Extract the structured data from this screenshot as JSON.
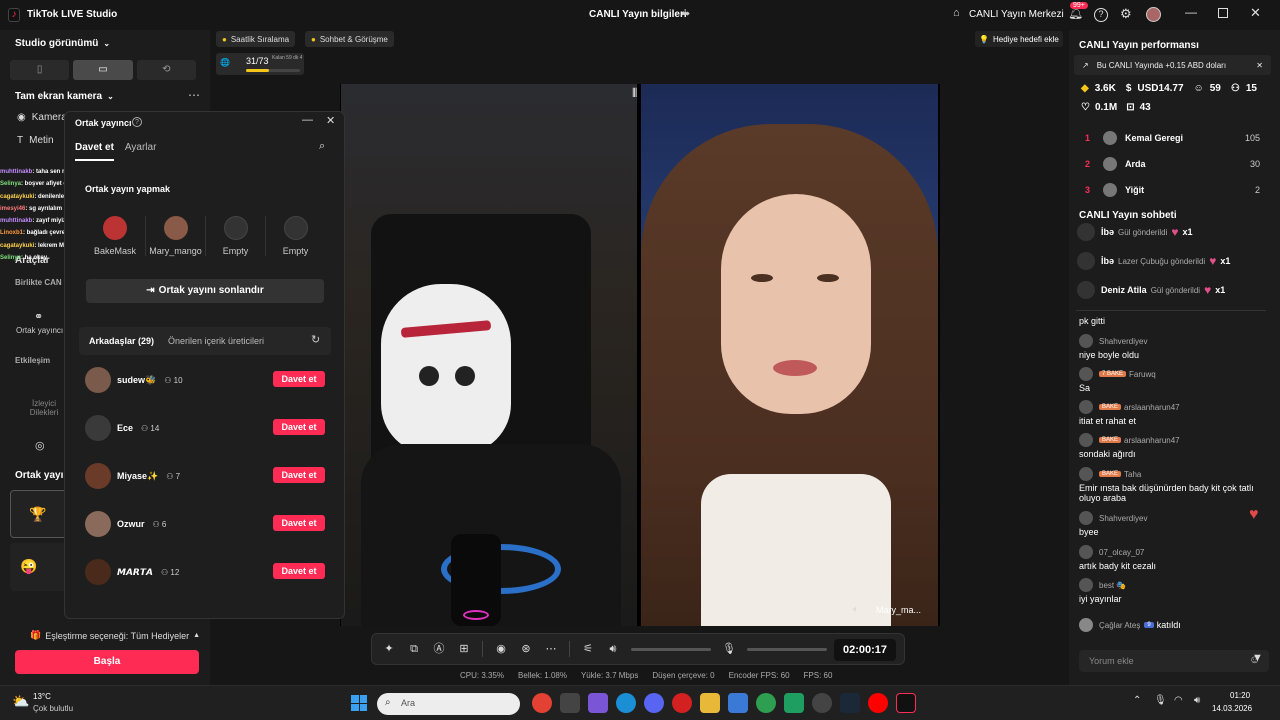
{
  "app": {
    "title": "TikTok LIVE Studio",
    "center_title": "CANLI Yayın bilgileri",
    "live_center": "CANLI Yayın Merkezi",
    "notif_badge": "99+"
  },
  "left": {
    "studio_view": "Studio görünümü",
    "fullscreen_camera": "Tam ekran kamera",
    "source_camera": "Kamera",
    "source_text": "Metin",
    "tools": "Araçlar",
    "together": "Birlikte CAN",
    "cohost_short": "Ortak yayıncı",
    "interaction": "Etkileşim",
    "viewer_requests": "İzleyici Dilekleri",
    "cohost_section": "Ortak yayın",
    "match_option": "Eşleştirme seçeneği: Tüm Hediyeler",
    "start": "Başla"
  },
  "overlay_chat": [
    {
      "user": "muhttinakb",
      "text": ": taha sen misin",
      "color": "#c38cff"
    },
    {
      "user": "Selinya",
      "text": ": boşver afiyet olsun",
      "color": "#7ee07e"
    },
    {
      "user": "cagataykuki",
      "text": ": denilenlere göre titi ben boznuşum",
      "color": "#ffd34d"
    },
    {
      "user": "imesyi46",
      "text": ": sg ayrılalım abi",
      "color": "#ff7a7a"
    },
    {
      "user": "muhttinakb",
      "text": ": zayıf miyiz abi",
      "color": "#c38cff"
    },
    {
      "user": "Linoxb1",
      "text": ": bağladı çevre kontrol",
      "color": "#ff9a3c"
    },
    {
      "user": "cagataykuki",
      "text": ": lekrem Mary hanum ben cago hatırladınız mı",
      "color": "#ffd34d"
    },
    {
      "user": "Selinya",
      "text": ": ha okey",
      "color": "#7ee07e"
    }
  ],
  "top_chips": {
    "hourly": "Saatlik Sıralama",
    "chat_meet": "Sohbet & Görüşme",
    "goal": "Hediye hedefi ekle",
    "progress": "31/73",
    "progress_fraction": 0.42,
    "timer_small": "Kalan 59 dk 48 sn"
  },
  "cohost": {
    "title": "Ortak yayıncı",
    "tab_invite": "Davet et",
    "tab_settings": "Ayarlar",
    "section": "Ortak yayın yapmak",
    "slots": [
      {
        "name": "BakeMask",
        "empty": false
      },
      {
        "name": "Mary_mango",
        "empty": false
      },
      {
        "name": "Empty",
        "empty": true
      },
      {
        "name": "Empty",
        "empty": true
      }
    ],
    "end_button": "Ortak yayını sonlandır",
    "friends_tab": "Arkadaşlar (29)",
    "suggested_tab": "Önerilen içerik üreticileri",
    "invite_label": "Davet et",
    "friends": [
      {
        "name": "sudew🐝",
        "count": "10"
      },
      {
        "name": "Ece",
        "count": "14"
      },
      {
        "name": "Miyase✨",
        "count": "7"
      },
      {
        "name": "Ozwur",
        "count": "6"
      },
      {
        "name": "𝙈𝘼𝙍𝙏𝘼",
        "count": "12"
      }
    ]
  },
  "video": {
    "right_label": "Mary_ma..."
  },
  "controls": {
    "timer": "02:00:17",
    "volume_level": 0.0,
    "mic_level": 0.0
  },
  "stats": [
    "CPU: 3.35%",
    "Bellek: 1.08%",
    "Yükle: 3.7 Mbps",
    "Düşen çerçeve: 0",
    "Encoder FPS: 60",
    "FPS: 60"
  ],
  "right": {
    "perf_title": "CANLI Yayın performansı",
    "earn_banner": "Bu CANLI Yayında +0.15 ABD doları",
    "metrics": {
      "diamonds": "3.6K",
      "usd": "USD14.77",
      "viewers": "59",
      "new": "15",
      "likes": "0.1M",
      "gifts": "43"
    },
    "ranks": [
      {
        "pos": "1",
        "name": "Kemal Geregi",
        "score": "105"
      },
      {
        "pos": "2",
        "name": "Arda",
        "score": "30"
      },
      {
        "pos": "3",
        "name": "Yiğit",
        "score": "2"
      }
    ],
    "chat_title": "CANLI Yayın sohbeti",
    "gift_events": [
      {
        "user": "İbə",
        "text": "Gül gönderildi",
        "mult": "x1"
      },
      {
        "user": "İbə",
        "text": "Lazer Çubuğu gönderildi",
        "mult": "x1"
      },
      {
        "user": "Deniz Atila",
        "text": "Gül gönderildi",
        "mult": "x1"
      }
    ],
    "messages": [
      {
        "user": "",
        "text": "pk gitti",
        "badge": ""
      },
      {
        "user": "Shahverdiyev",
        "text": "niye boyle oldu",
        "badge": ""
      },
      {
        "user": "Faruwq",
        "text": "Sa",
        "badge": "7 BAKE"
      },
      {
        "user": "arslaanharun47",
        "text": "itiat et rahat et",
        "badge": "BAKE"
      },
      {
        "user": "arslaanharun47",
        "text": "sondaki ağırdı",
        "badge": "BAKE"
      },
      {
        "user": "Taha",
        "text": "Emir ınsta bak düşünürden bady kit çok tatlı oluyo araba",
        "badge": "BAKE"
      },
      {
        "user": "Shahverdiyev",
        "text": "byee",
        "badge": ""
      },
      {
        "user": "07_olcay_07",
        "text": "artık bady kit cezalı",
        "badge": ""
      },
      {
        "user": "best 🎭",
        "text": "iyi yayınlar",
        "badge": ""
      }
    ],
    "joined_user": "Çağlar Ateş",
    "joined_badge": "9",
    "joined_text": "katıldı",
    "comment_placeholder": "Yorum ekle"
  },
  "taskbar": {
    "weather_temp": "13°C",
    "weather_desc": "Çok bulutlu",
    "search_placeholder": "Ara",
    "time": "01:20",
    "date": "14.03.2026"
  }
}
